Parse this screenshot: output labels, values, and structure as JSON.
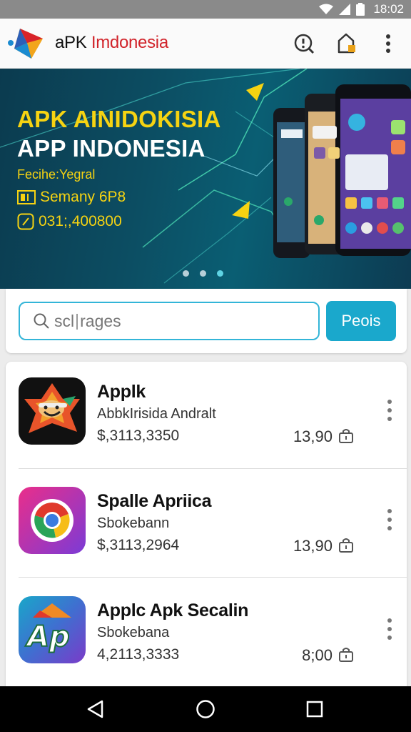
{
  "status_bar": {
    "time": "18:02",
    "icons": [
      "wifi-icon",
      "signal-icon",
      "battery-icon"
    ]
  },
  "app_bar": {
    "title_part1": "aPK ",
    "title_part2": "Imdonesia",
    "actions": [
      "info-icon",
      "share-icon",
      "more-vert-icon"
    ]
  },
  "banner": {
    "headline1": "APK AINIDOKISIA",
    "headline2": "APP INDONESIA",
    "subtitle": "Fecihe:Yegral",
    "line1": "Semany 6P8",
    "line2": "031;,400800",
    "pages": 3,
    "active_page": 1
  },
  "search": {
    "placeholder": "scl",
    "value_suffix": "rages",
    "button_label": "Peois"
  },
  "apps": [
    {
      "name": "Applk",
      "subtitle": "AbbkIrisida Andralt",
      "price": "$,3113,3350",
      "rating": "13,90"
    },
    {
      "name": "Spalle Apriica",
      "subtitle": "Sbokebann",
      "price": "$,3113,2964",
      "rating": "13,90"
    },
    {
      "name": "Applc Apk Secalin",
      "subtitle": "Sbokebana",
      "price": "4,2113,3333",
      "rating": "8;00"
    }
  ],
  "colors": {
    "accent": "#1aa8cc",
    "banner_yellow": "#f6d312",
    "title_red": "#d1232a",
    "status_bar": "#8a8a8a"
  }
}
